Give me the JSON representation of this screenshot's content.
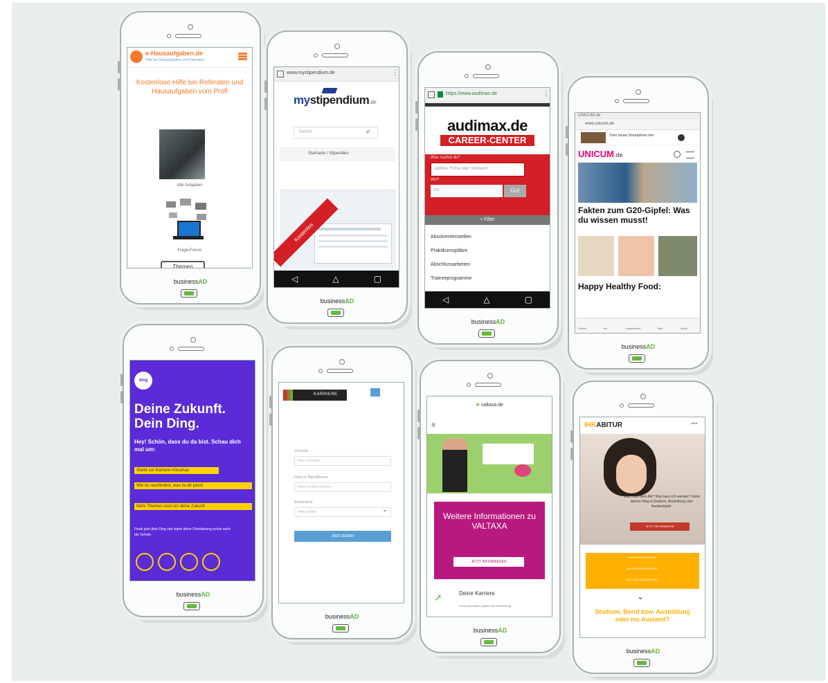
{
  "brand_label": "business",
  "brand_suffix": "AD",
  "p1": {
    "logo_title": "e-Hausaufgaben.de",
    "logo_sub": "Hilfe bei Hausaufgaben und Referaten",
    "headline": "Kostenlose Hilfe bei Referaten und Hausaufgaben vom Profi",
    "caption1": "Alle Aufgaben",
    "caption2": "Frage-Forum",
    "button": "Themen"
  },
  "p2": {
    "url": "www.mystipendium.de",
    "logo_a": "my",
    "logo_b": "stipendium",
    "logo_c": ".de",
    "search_placeholder": "Suche",
    "crumb": "Startseite / Stipendien",
    "ribbon": "Kostenlos"
  },
  "p3": {
    "url": "https://www.audimax.de",
    "logo": "audimax.de",
    "band": "CAREER-CENTER",
    "label1": "Was suchst du?",
    "input1": "Jobtitel, Firma oder Stichwort",
    "label2": "Wo?",
    "input2": "Ort",
    "go": "Go!",
    "filter": "+ Filter",
    "menu": [
      "Absolventenstellen",
      "Praktikumsplätze",
      "Abschlussarbeiten",
      "Traineeprogramme"
    ]
  },
  "p4": {
    "status": "UNICUM.de",
    "url": "www.unicum.de",
    "ad_text": "Dein neues Smartphone hier",
    "logo": "UNICUM",
    "logo_suffix": ".de",
    "headline1": "Fakten zum G20-Gipfel: Was du wissen musst!",
    "headline2": "Happy Healthy Food:",
    "nav": [
      "Zurück",
      "Vor",
      "Lesezeichen",
      "Tabs",
      "Menü"
    ]
  },
  "p5": {
    "badge": "ding",
    "title": "Deine Zukunft. Dein Ding.",
    "intro": "Hey! Schön, dass du da bist. Schau dich mal um:",
    "btn1": "Starte zur Karriere-Vorschau",
    "btn2": "Wie du rausfindest, was zu dir passt",
    "btn3": "Mehr Themen rund um deine Zukunft",
    "footer": "Finde jetzt dein Ding und starte deine Orientierung schon nach der Schule."
  },
  "p6": {
    "logo": "KARRIERE",
    "label1": "Vorname",
    "ph1": "Dein Vorname",
    "label2": "Deine E-Mail-Adresse",
    "ph2": "Deine E-Mail-Adresse",
    "label3": "Bundesland",
    "ph3": "Bitte wählen",
    "submit": "Jetzt starten"
  },
  "p7": {
    "logo": "valtaxa.de",
    "promo_title": "Weitere Informationen zu VALTAXA",
    "promo_button": "JETZT INFORMIEREN",
    "career_title": "Deine Karriere",
    "career_sub": "Finde jetzt deinen passenden Karriereweg"
  },
  "p8": {
    "logo": "ABITUR",
    "logo_prefix": "IHK",
    "question": "Was nach dem Abi? Was kann ich werden? Finde deinen Weg in Studium, Ausbildung oder Auslandsjahr.",
    "cta": "JETZT INFORMIEREN",
    "opt1": "MEIN STUDIENGANG",
    "opt2": "AUSBILDUNGSBERUFE",
    "opt3": "AUSLANDSAUFENTHALT",
    "bottom": "Studium, Beruf bzw. Ausbildung oder ins Ausland?"
  },
  "colors": {
    "orange": "#f37a2a",
    "red": "#d31f26",
    "purple": "#5a2bd6",
    "yellow": "#ffd200",
    "magenta": "#b8197f",
    "green": "#67b93b",
    "blue": "#1f3f8f"
  }
}
